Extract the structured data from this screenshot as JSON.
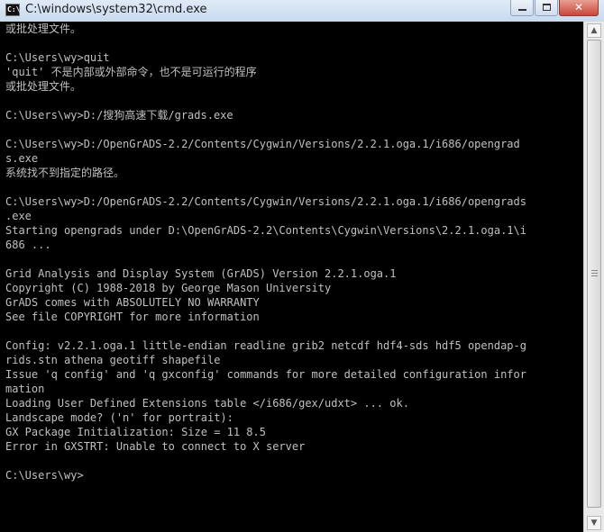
{
  "window": {
    "title": "C:\\windows\\system32\\cmd.exe",
    "icon_label": "C:\\",
    "minimize_icon": "minimize-icon",
    "maximize_icon": "maximize-icon",
    "close_icon": "close-icon",
    "close_glyph": "✕"
  },
  "console": {
    "text": "或批处理文件。\n\nC:\\Users\\wy>quit\n'quit' 不是内部或外部命令，也不是可运行的程序\n或批处理文件。\n\nC:\\Users\\wy>D:/搜狗高速下载/grads.exe\n\nC:\\Users\\wy>D:/OpenGrADS-2.2/Contents/Cygwin/Versions/2.2.1.oga.1/i686/opengrad\ns.exe\n系统找不到指定的路径。\n\nC:\\Users\\wy>D:/OpenGrADS-2.2/Contents/Cygwin/Versions/2.2.1.oga.1/i686/opengrads\n.exe\nStarting opengrads under D:\\OpenGrADS-2.2\\Contents\\Cygwin\\Versions\\2.2.1.oga.1\\i\n686 ...\n\nGrid Analysis and Display System (GrADS) Version 2.2.1.oga.1\nCopyright (C) 1988-2018 by George Mason University\nGrADS comes with ABSOLUTELY NO WARRANTY\nSee file COPYRIGHT for more information\n\nConfig: v2.2.1.oga.1 little-endian readline grib2 netcdf hdf4-sds hdf5 opendap-g\nrids.stn athena geotiff shapefile\nIssue 'q config' and 'q gxconfig' commands for more detailed configuration infor\nmation\nLoading User Defined Extensions table </i686/gex/udxt> ... ok.\nLandscape mode? ('n' for portrait):\nGX Package Initialization: Size = 11 8.5\nError in GXSTRT: Unable to connect to X server\n\nC:\\Users\\wy>"
  },
  "scrollbar": {
    "up_icon": "scroll-up-arrow-icon",
    "down_icon": "scroll-down-arrow-icon",
    "up_glyph": "▲",
    "down_glyph": "▼"
  }
}
